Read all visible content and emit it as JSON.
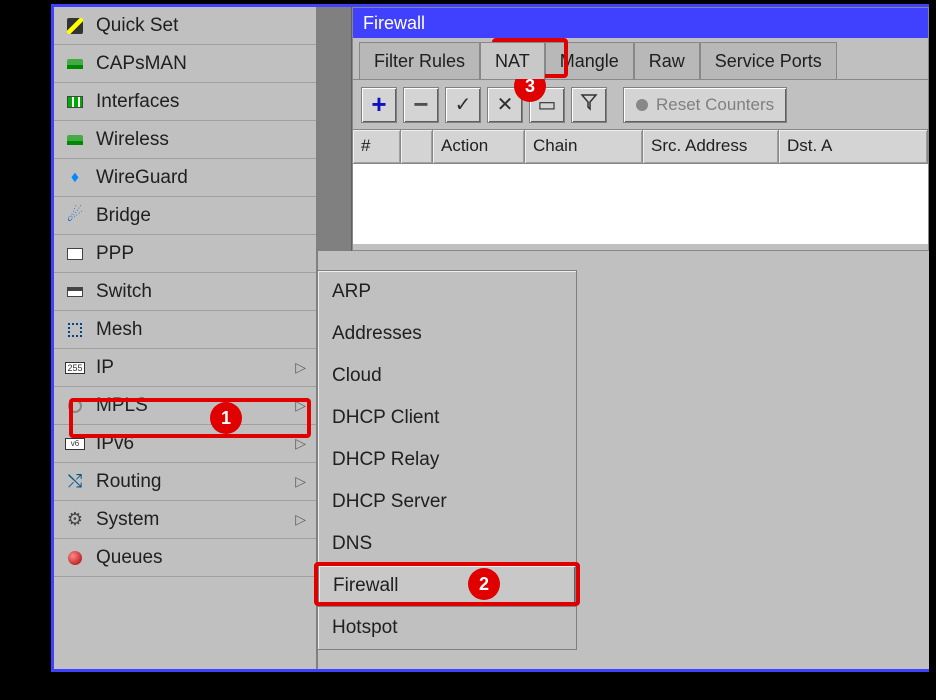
{
  "sidebar": {
    "items": [
      {
        "label": "Quick Set",
        "icon": "magic-wand-icon",
        "arrow": false
      },
      {
        "label": "CAPsMAN",
        "icon": "capsman-icon",
        "arrow": false
      },
      {
        "label": "Interfaces",
        "icon": "interfaces-icon",
        "arrow": false
      },
      {
        "label": "Wireless",
        "icon": "wireless-icon",
        "arrow": false
      },
      {
        "label": "WireGuard",
        "icon": "wireguard-icon",
        "arrow": false
      },
      {
        "label": "Bridge",
        "icon": "bridge-icon",
        "arrow": false
      },
      {
        "label": "PPP",
        "icon": "ppp-icon",
        "arrow": false
      },
      {
        "label": "Switch",
        "icon": "switch-icon",
        "arrow": false
      },
      {
        "label": "Mesh",
        "icon": "mesh-icon",
        "arrow": false
      },
      {
        "label": "IP",
        "icon": "ip-icon",
        "arrow": true
      },
      {
        "label": "MPLS",
        "icon": "mpls-icon",
        "arrow": true
      },
      {
        "label": "IPv6",
        "icon": "ipv6-icon",
        "arrow": true
      },
      {
        "label": "Routing",
        "icon": "routing-icon",
        "arrow": true
      },
      {
        "label": "System",
        "icon": "system-icon",
        "arrow": true
      },
      {
        "label": "Queues",
        "icon": "queues-icon",
        "arrow": false
      }
    ]
  },
  "submenu": {
    "items": [
      {
        "label": "ARP"
      },
      {
        "label": "Addresses"
      },
      {
        "label": "Cloud"
      },
      {
        "label": "DHCP Client"
      },
      {
        "label": "DHCP Relay"
      },
      {
        "label": "DHCP Server"
      },
      {
        "label": "DNS"
      },
      {
        "label": "Firewall"
      },
      {
        "label": "Hotspot"
      }
    ],
    "selected_index": 7
  },
  "firewall": {
    "title": "Firewall",
    "tabs": [
      {
        "label": "Filter Rules"
      },
      {
        "label": "NAT"
      },
      {
        "label": "Mangle"
      },
      {
        "label": "Raw"
      },
      {
        "label": "Service Ports"
      }
    ],
    "active_tab_index": 1,
    "toolbar": {
      "add": "+",
      "remove": "−",
      "enable": "✓",
      "disable": "✕",
      "comment": "▭",
      "filter": "▼",
      "reset_counters_label": "Reset Counters"
    },
    "columns": [
      {
        "label": "#",
        "width": 48
      },
      {
        "label": "",
        "width": 32
      },
      {
        "label": "Action",
        "width": 92
      },
      {
        "label": "Chain",
        "width": 118
      },
      {
        "label": "Src. Address",
        "width": 136
      },
      {
        "label": "Dst. A",
        "width": 80
      }
    ]
  },
  "annotations": {
    "label1": "1",
    "label2": "2",
    "label3": "3"
  },
  "glyphs": {
    "arrow_right": "▷"
  }
}
